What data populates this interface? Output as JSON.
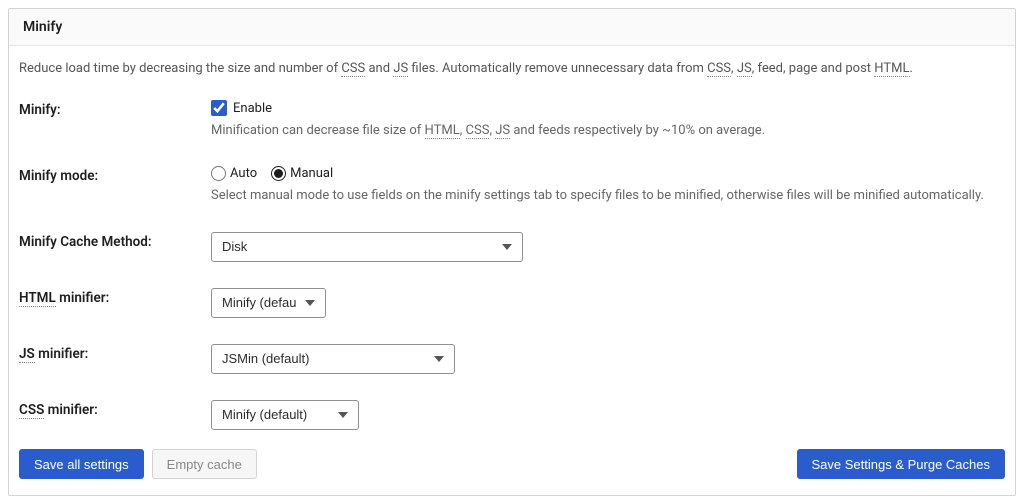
{
  "panel": {
    "title": "Minify",
    "desc_prefix": "Reduce load time by decreasing the size and number of ",
    "desc_css": "CSS",
    "desc_and": " and ",
    "desc_js": "JS",
    "desc_mid": " files. Automatically remove unnecessary data from ",
    "desc_css2": "CSS",
    "desc_sep": ", ",
    "desc_js2": "JS",
    "desc_feed": ", feed, page and post ",
    "desc_html": "HTML",
    "desc_end": "."
  },
  "minify": {
    "label": "Minify:",
    "enable_label": "Enable",
    "hint_prefix": "Minification can decrease file size of ",
    "hint_html": "HTML",
    "hint_sep1": ", ",
    "hint_css": "CSS",
    "hint_sep2": ", ",
    "hint_js": "JS",
    "hint_suffix": " and feeds respectively by ~10% on average."
  },
  "mode": {
    "label": "Minify mode:",
    "auto": "Auto",
    "manual": "Manual",
    "hint": "Select manual mode to use fields on the minify settings tab to specify files to be minified, otherwise files will be minified automatically."
  },
  "cache_method": {
    "label": "Minify Cache Method:",
    "value": "Disk"
  },
  "html_minifier": {
    "label_abbr": "HTML",
    "label_suffix": " minifier:",
    "value": "Minify (default)"
  },
  "js_minifier": {
    "label_abbr": "JS",
    "label_suffix": " minifier:",
    "value": "JSMin (default)"
  },
  "css_minifier": {
    "label_abbr": "CSS",
    "label_suffix": " minifier:",
    "value": "Minify (default)"
  },
  "actions": {
    "save_all": "Save all settings",
    "empty_cache": "Empty cache",
    "save_purge": "Save Settings & Purge Caches"
  }
}
